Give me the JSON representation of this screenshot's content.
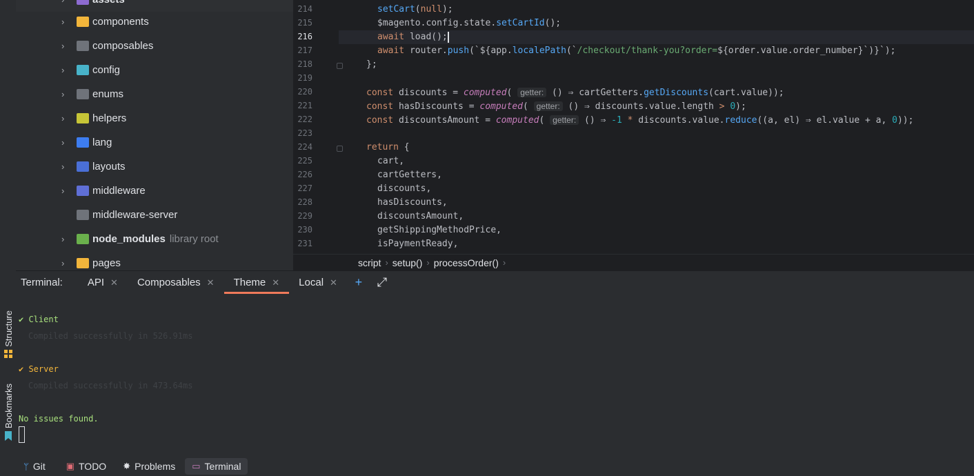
{
  "tool_strip": {
    "structure_label": "Structure",
    "bookmarks_label": "Bookmarks"
  },
  "project_tree": {
    "items": [
      {
        "name": "assets",
        "icon": "folder-purple-icon",
        "color": "#8d6bd1",
        "expanded": false
      },
      {
        "name": "components",
        "icon": "folder-components-icon",
        "color": "#f2b53b"
      },
      {
        "name": "composables",
        "icon": "folder-icon",
        "color": "#6f737a"
      },
      {
        "name": "config",
        "icon": "folder-config-icon",
        "color": "#48b3c9"
      },
      {
        "name": "enums",
        "icon": "folder-enums-icon",
        "color": "#6f737a"
      },
      {
        "name": "helpers",
        "icon": "folder-helpers-icon",
        "color": "#c6c537"
      },
      {
        "name": "lang",
        "icon": "folder-lang-icon",
        "color": "#3d7df0"
      },
      {
        "name": "layouts",
        "icon": "folder-layouts-icon",
        "color": "#4a6fd6"
      },
      {
        "name": "middleware",
        "icon": "folder-middleware-icon",
        "color": "#5f6fd6"
      },
      {
        "name": "middleware-server",
        "icon": "folder-icon",
        "color": "#6f737a"
      },
      {
        "name": "node_modules",
        "sub": "library root",
        "icon": "folder-node-modules-icon",
        "color": "#6ab04c"
      },
      {
        "name": "pages",
        "icon": "folder-pages-icon",
        "color": "#f2b53b"
      }
    ]
  },
  "editor": {
    "line_numbers": [
      "214",
      "215",
      "216",
      "217",
      "218",
      "219",
      "220",
      "221",
      "222",
      "223",
      "224",
      "225",
      "226",
      "227",
      "228",
      "229",
      "230",
      "231"
    ],
    "current_line": "216",
    "lines": {
      "l214": [
        "setCart",
        "(",
        "null",
        ");"
      ],
      "l215": [
        "$magento.config.state.",
        "setCartId",
        "();"
      ],
      "l216": [
        "await",
        "load",
        "();"
      ],
      "l217": [
        "await",
        "router.",
        "push",
        "(`${app.",
        "localePath",
        "(`",
        "/checkout/thank-you?order=",
        "${order.value.order_number}",
        "`)}`);"
      ],
      "l218": "};",
      "l220": [
        "const",
        "discounts",
        "=",
        "computed",
        "(",
        "getter:",
        "() ⇒",
        "cartGetters.",
        "getDiscounts",
        "(cart.value));"
      ],
      "l221": [
        "const",
        "hasDiscounts",
        "=",
        "computed",
        "(",
        "getter:",
        "() ⇒",
        "discounts.value.length",
        ">",
        "0",
        ");"
      ],
      "l222": [
        "const",
        "discountsAmount",
        "=",
        "computed",
        "(",
        "getter:",
        "() ⇒",
        "-1",
        "*",
        "discounts.value.",
        "reduce",
        "((a, el) ⇒ el.value + a, ",
        "0",
        "));"
      ],
      "l224": [
        "return",
        "{"
      ],
      "l225": "cart,",
      "l226": "cartGetters,",
      "l227": "discounts,",
      "l228": "hasDiscounts,",
      "l229": "discountsAmount,",
      "l230": "getShippingMethodPrice,",
      "l231": "isPaymentReady,"
    }
  },
  "breadcrumbs": [
    "script",
    "setup()",
    "processOrder()"
  ],
  "terminal": {
    "title": "Terminal:",
    "tabs": [
      {
        "label": "API",
        "active": false
      },
      {
        "label": "Composables",
        "active": false
      },
      {
        "label": "Theme",
        "active": true
      },
      {
        "label": "Local",
        "active": false
      }
    ],
    "add_label": "+",
    "expand_label": "⤢",
    "output": {
      "client": "✔ Client",
      "client_detail": "Compiled successfully in 526.91ms",
      "server": "✔ Server",
      "server_detail": "Compiled successfully in 473.64ms",
      "summary": "No issues found."
    }
  },
  "bottom_bar": {
    "git": "Git",
    "todo": "TODO",
    "problems": "Problems",
    "terminal": "Terminal"
  },
  "colors": {
    "accent_tab": "#ef7a5b",
    "success": "#a8e07d",
    "warning": "#f2b53b"
  }
}
